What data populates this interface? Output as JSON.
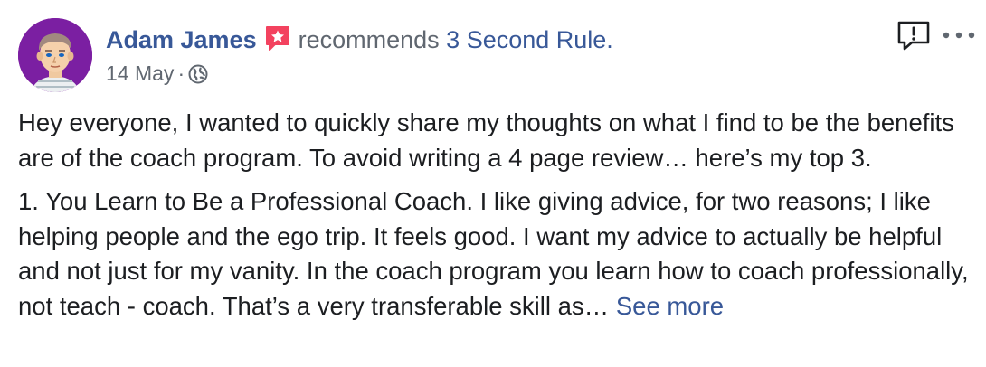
{
  "post": {
    "author": "Adam James",
    "action": "recommends",
    "page": "3 Second Rule.",
    "date": "14 May",
    "separator": "·",
    "privacy_icon": "globe-icon",
    "recommend_icon": "recommend-star-icon",
    "report_icon": "report-icon",
    "more_icon": "more-options-icon",
    "paragraphs": [
      "Hey everyone, I wanted to quickly share my thoughts on what I find to be the benefits are of the coach program. To avoid writing a 4 page review… here’s my top 3.",
      "1. You Learn to Be a Professional Coach. I like giving advice, for two reasons; I like helping people and the ego trip. It feels good. I want my advice to actually be helpful and not just for my vanity. In the coach program you learn how to coach professionally, not teach - coach. That’s a very transferable skill as…"
    ],
    "see_more": "See more"
  },
  "colors": {
    "link": "#385898",
    "muted": "#606770",
    "text": "#1c1e21",
    "recommend": "#f3425f",
    "avatar_bg": "#7b1fa2"
  }
}
